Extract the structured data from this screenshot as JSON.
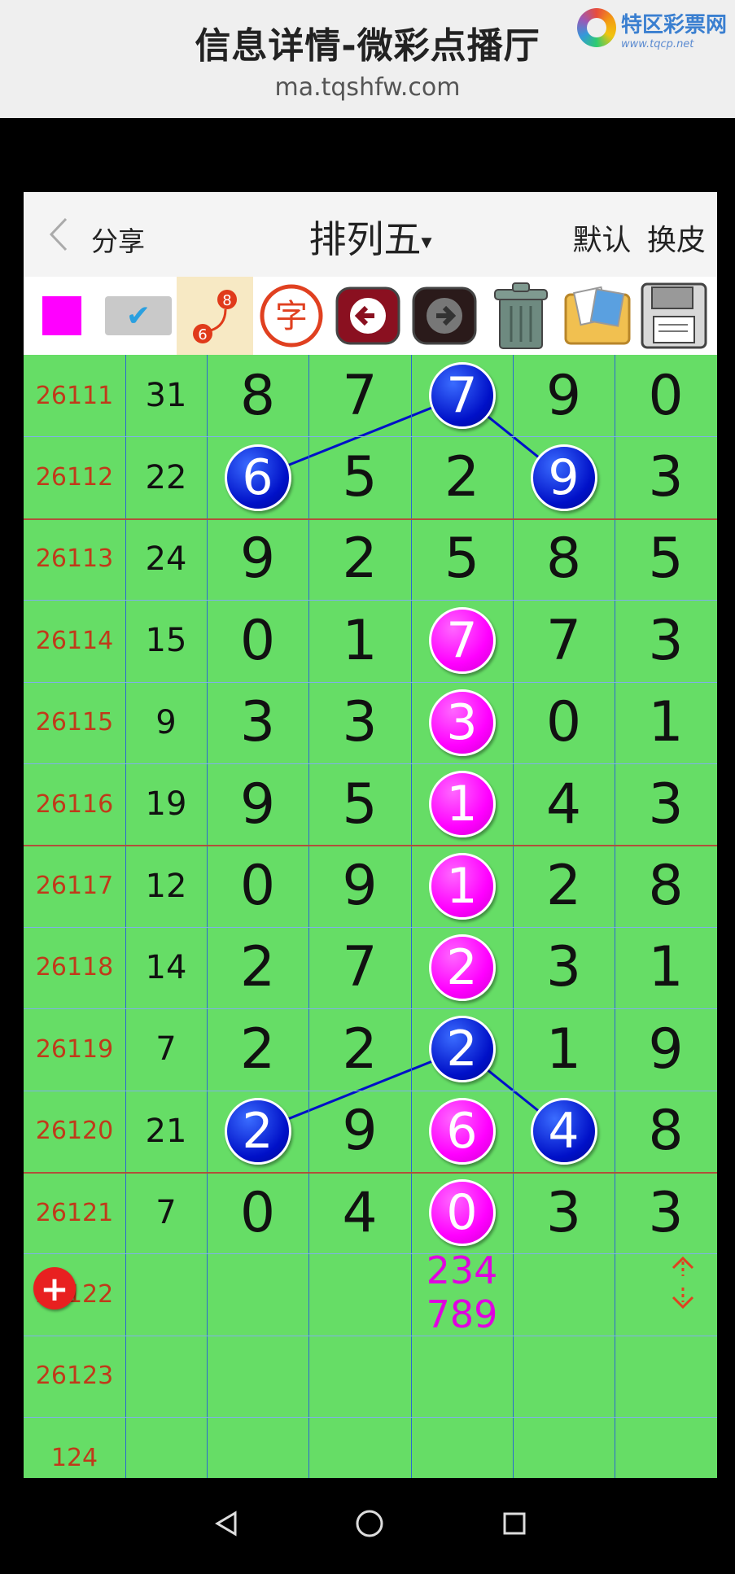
{
  "page": {
    "title": "信息详情-微彩点播厅",
    "url": "ma.tqshfw.com",
    "brand_name": "特区彩票网",
    "brand_site": "www.tqcp.net"
  },
  "header": {
    "back_icon": "chevron-left-icon",
    "share_label": "分享",
    "title": "排列五",
    "caret": "▾",
    "default_label": "默认",
    "skin_label": "换皮"
  },
  "toolbar": {
    "tools": [
      "magenta-square-icon",
      "checkmark-icon",
      "connect-line-icon",
      "character-icon",
      "arrow-left-icon",
      "arrow-right-icon",
      "trash-icon",
      "pictures-icon",
      "floppy-disk-icon"
    ],
    "colors": {
      "magenta": "#ff00ff",
      "blue": "#0010c8",
      "grid_green": "#66dd66"
    }
  },
  "table": {
    "rows": [
      {
        "issue": "26111",
        "sum": "31",
        "digits": [
          "8",
          "7",
          "7",
          "9",
          "0"
        ],
        "balls": [
          null,
          null,
          "blue",
          null,
          null
        ]
      },
      {
        "issue": "26112",
        "sum": "22",
        "digits": [
          "6",
          "5",
          "2",
          "9",
          "3"
        ],
        "balls": [
          "blue",
          null,
          null,
          "blue",
          null
        ]
      },
      {
        "issue": "26113",
        "sum": "24",
        "digits": [
          "9",
          "2",
          "5",
          "8",
          "5"
        ],
        "balls": [
          null,
          null,
          null,
          null,
          null
        ]
      },
      {
        "issue": "26114",
        "sum": "15",
        "digits": [
          "0",
          "1",
          "7",
          "7",
          "3"
        ],
        "balls": [
          null,
          null,
          "mag",
          null,
          null
        ]
      },
      {
        "issue": "26115",
        "sum": "9",
        "digits": [
          "3",
          "3",
          "3",
          "0",
          "1"
        ],
        "balls": [
          null,
          null,
          "mag",
          null,
          null
        ]
      },
      {
        "issue": "26116",
        "sum": "19",
        "digits": [
          "9",
          "5",
          "1",
          "4",
          "3"
        ],
        "balls": [
          null,
          null,
          "mag",
          null,
          null
        ]
      },
      {
        "issue": "26117",
        "sum": "12",
        "digits": [
          "0",
          "9",
          "1",
          "2",
          "8"
        ],
        "balls": [
          null,
          null,
          "mag",
          null,
          null
        ]
      },
      {
        "issue": "26118",
        "sum": "14",
        "digits": [
          "2",
          "7",
          "2",
          "3",
          "1"
        ],
        "balls": [
          null,
          null,
          "mag",
          null,
          null
        ]
      },
      {
        "issue": "26119",
        "sum": "7",
        "digits": [
          "2",
          "2",
          "2",
          "1",
          "9"
        ],
        "balls": [
          null,
          null,
          "blue",
          null,
          null
        ]
      },
      {
        "issue": "26120",
        "sum": "21",
        "digits": [
          "2",
          "9",
          "6",
          "4",
          "8"
        ],
        "balls": [
          "blue",
          null,
          "mag",
          "blue",
          null
        ]
      },
      {
        "issue": "26121",
        "sum": "7",
        "digits": [
          "0",
          "4",
          "0",
          "3",
          "3"
        ],
        "balls": [
          null,
          null,
          "mag",
          null,
          null
        ]
      },
      {
        "issue": "26122",
        "sum": "",
        "digits": [
          "",
          "",
          "",
          "",
          ""
        ],
        "balls": [
          null,
          null,
          null,
          null,
          null
        ]
      },
      {
        "issue": "26123",
        "sum": "",
        "digits": [
          "",
          "",
          "",
          "",
          ""
        ],
        "balls": [
          null,
          null,
          null,
          null,
          null
        ]
      },
      {
        "issue": "124",
        "sum": "",
        "digits": [
          "",
          "",
          "",
          "",
          ""
        ],
        "balls": [
          null,
          null,
          null,
          null,
          null
        ]
      }
    ],
    "prediction": {
      "row": "26122",
      "line1": "234",
      "line2": "789"
    },
    "separator_rows": [
      "26112",
      "26116",
      "26120"
    ]
  },
  "controls": {
    "add_icon": "plus-circle-icon",
    "scroll_icon": "up-down-arrows-icon"
  },
  "navbar": {
    "back_icon": "nav-back-icon",
    "home_icon": "nav-home-icon",
    "recents_icon": "nav-recents-icon"
  }
}
